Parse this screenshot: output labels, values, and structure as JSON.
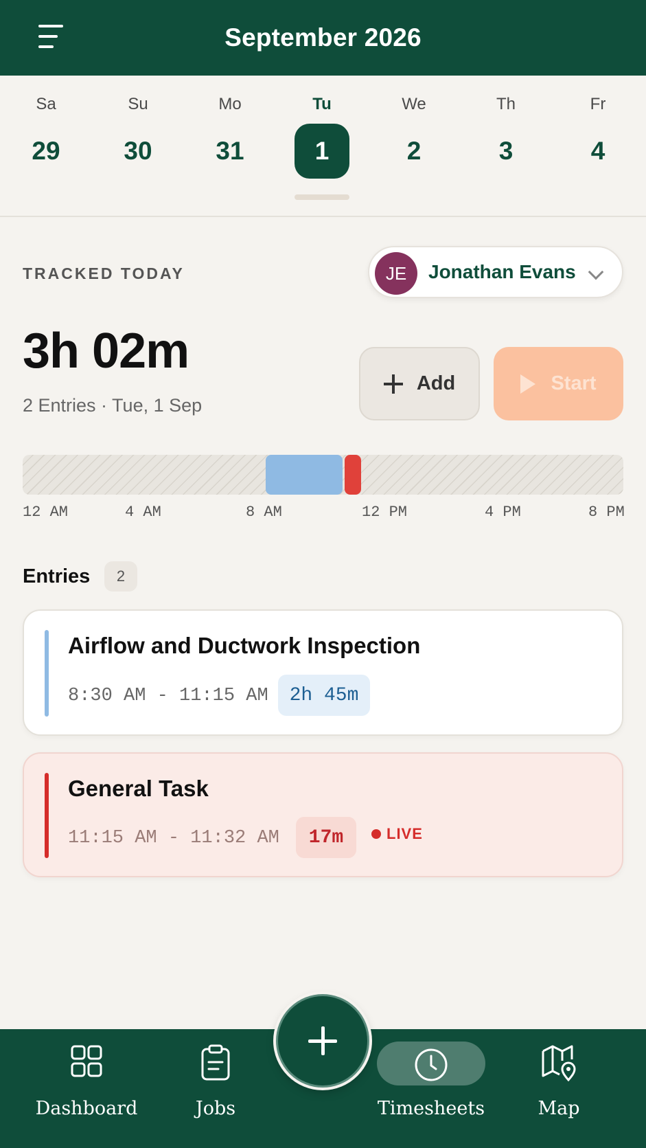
{
  "header": {
    "title": "September 2026"
  },
  "week": [
    {
      "name": "Sa",
      "date": "29",
      "selected": false
    },
    {
      "name": "Su",
      "date": "30",
      "selected": false
    },
    {
      "name": "Mo",
      "date": "31",
      "selected": false
    },
    {
      "name": "Tu",
      "date": "1",
      "selected": true
    },
    {
      "name": "We",
      "date": "2",
      "selected": false
    },
    {
      "name": "Th",
      "date": "3",
      "selected": false
    },
    {
      "name": "Fr",
      "date": "4",
      "selected": false
    }
  ],
  "summary": {
    "label": "TRACKED TODAY",
    "total": "3h 02m",
    "subtitle": "2 Entries · Tue, 1 Sep"
  },
  "user": {
    "initials": "JE",
    "name": "Jonathan Evans"
  },
  "actions": {
    "add_label": "Add",
    "start_label": "Start"
  },
  "timeline": {
    "ticks": [
      "12 AM",
      "4 AM",
      "8 AM",
      "12 PM",
      "4 PM",
      "8 PM"
    ],
    "segments": [
      {
        "start": "8:30 AM",
        "end": "11:15 AM",
        "color": "#8fbae3"
      },
      {
        "start": "11:15 AM",
        "end": "11:32 AM",
        "color": "#e0413a"
      }
    ]
  },
  "entries_section": {
    "title": "Entries",
    "count": "2"
  },
  "entries": [
    {
      "title": "Airflow and Ductwork Inspection",
      "time": "8:30 AM - 11:15 AM",
      "duration": "2h 45m",
      "accent": "#8fbae3",
      "live": false
    },
    {
      "title": "General Task",
      "time": "11:15 AM - 11:32 AM",
      "duration": "17m",
      "accent": "#d52d2b",
      "live": true,
      "live_label": "LIVE"
    }
  ],
  "nav": [
    {
      "label": "Dashboard",
      "icon": "grid-icon"
    },
    {
      "label": "Jobs",
      "icon": "clipboard-icon"
    },
    {
      "label": "Timesheets",
      "icon": "clock-icon",
      "active": true
    },
    {
      "label": "Map",
      "icon": "map-pin-icon"
    }
  ],
  "colors": {
    "brand": "#0f4d3a",
    "start_button": "#fbc19f",
    "avatar": "#85325d"
  }
}
